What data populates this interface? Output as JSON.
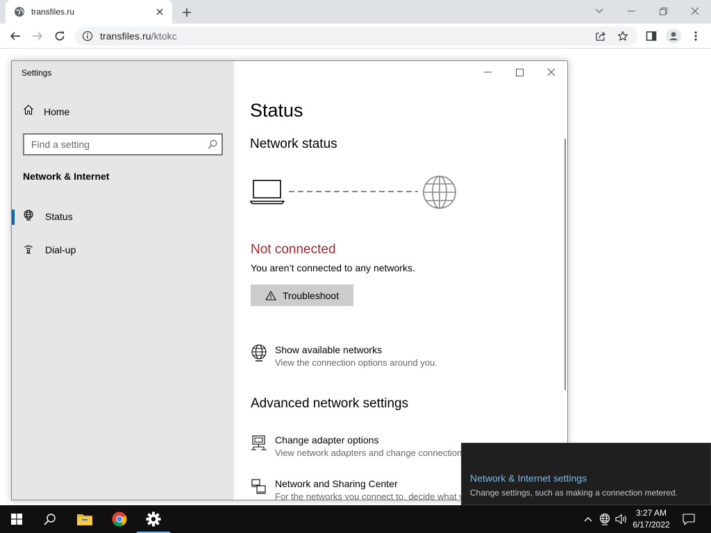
{
  "browser": {
    "tab_title": "transfiles.ru",
    "url_host": "transfiles.ru",
    "url_path": "/ktokc",
    "icons": [
      "globe-icon",
      "close-icon",
      "plus-icon",
      "chevron-down-icon",
      "minimize-icon",
      "restore-icon",
      "close-icon",
      "back-icon",
      "forward-icon",
      "reload-icon",
      "info-icon",
      "share-icon",
      "star-icon",
      "side-panel-icon",
      "profile-icon",
      "more-vert-icon"
    ]
  },
  "settings_window": {
    "title": "Settings",
    "sidebar": {
      "home_label": "Home",
      "search_placeholder": "Find a setting",
      "section_title": "Network & Internet",
      "items": [
        {
          "label": "Status",
          "icon": "globe-icon",
          "selected": true
        },
        {
          "label": "Dial-up",
          "icon": "dial-up-icon",
          "selected": false
        }
      ]
    },
    "content": {
      "page_title": "Status",
      "network_status_heading": "Network status",
      "connection_state": "Not connected",
      "connection_description": "You aren’t connected to any networks.",
      "troubleshoot_label": "Troubleshoot",
      "show_networks": {
        "title": "Show available networks",
        "description": "View the connection options around you."
      },
      "advanced_heading": "Advanced network settings",
      "change_adapter": {
        "title": "Change adapter options",
        "description": "View network adapters and change connection settings."
      },
      "sharing_center": {
        "title": "Network and Sharing Center",
        "description": "For the networks you connect to, decide what you want to share."
      }
    }
  },
  "toast": {
    "title": "Network & Internet settings",
    "description": "Change settings, such as making a connection metered."
  },
  "taskbar": {
    "apps": [
      "start-icon",
      "search-icon",
      "file-explorer-icon",
      "chrome-icon",
      "settings-icon"
    ],
    "clock_time": "3:27 AM",
    "clock_date": "6/17/2022"
  },
  "colors": {
    "accent": "#0067c0",
    "error_text": "#a4262c",
    "toast_link": "#76b9ed"
  }
}
